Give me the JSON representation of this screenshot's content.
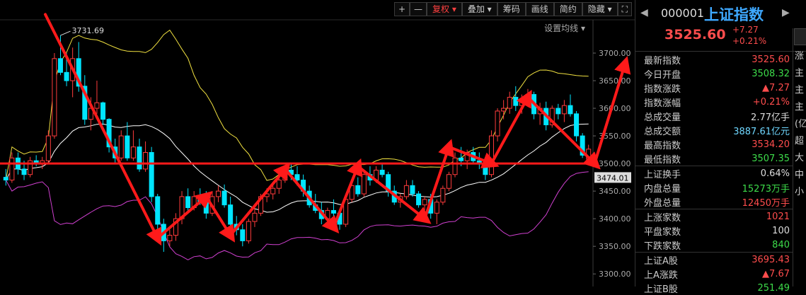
{
  "toolbar": {
    "plus": "+",
    "minus": "—",
    "fuquan": "复权 ▾",
    "diejia": "叠加 ▾",
    "chouma": "筹码",
    "huaxian": "画线",
    "jianyue": "简约",
    "yincang": "隐藏 ▾",
    "fullscreen": "⛶",
    "ma_setting": "设置均线 ▾"
  },
  "quote": {
    "code": "000001",
    "name": "上证指数",
    "price": "3525.60",
    "change": "+7.27",
    "change_pct": "+0.21%",
    "rows": [
      {
        "label": "最新指数",
        "value": "3525.60",
        "color": "#ff4d4d"
      },
      {
        "label": "今日开盘",
        "value": "3508.32",
        "color": "#3ddc4a"
      },
      {
        "label": "指数涨跌",
        "value": "▲7.27",
        "color": "#ff4d4d"
      },
      {
        "label": "指数涨幅",
        "value": "+0.21%",
        "color": "#ff4d4d"
      },
      {
        "label": "总成交量",
        "value": "2.77亿手",
        "color": "#dddddd"
      },
      {
        "label": "总成交额",
        "value": "3887.61亿元",
        "color": "#6fd7ff"
      },
      {
        "label": "最高指数",
        "value": "3534.20",
        "color": "#ff4d4d"
      },
      {
        "label": "最低指数",
        "value": "3507.35",
        "color": "#3ddc4a"
      },
      {
        "label": "上证换手",
        "value": "0.64%",
        "color": "#dddddd",
        "sep": true
      },
      {
        "label": "内盘总量",
        "value": "15273万手",
        "color": "#3ddc4a"
      },
      {
        "label": "外盘总量",
        "value": "12450万手",
        "color": "#ff4d4d"
      },
      {
        "label": "上涨家数",
        "value": "1021",
        "color": "#ff4d4d",
        "sep": true
      },
      {
        "label": "平盘家数",
        "value": "100",
        "color": "#dddddd"
      },
      {
        "label": "下跌家数",
        "value": "840",
        "color": "#3ddc4a"
      },
      {
        "label": "上证A股",
        "value": "3695.43",
        "color": "#ff4d4d",
        "sep": true
      },
      {
        "label": "上A涨跌",
        "value": "▲7.67",
        "color": "#ff4d4d"
      },
      {
        "label": "上证B股",
        "value": "251.49",
        "color": "#3ddc4a"
      }
    ],
    "strip": [
      "涨",
      "主",
      "主",
      "主",
      "(亿",
      "超",
      "大",
      "中",
      "小"
    ]
  },
  "chart_data": {
    "type": "candlestick",
    "y_ticks": [
      "3700.00",
      "3650.00",
      "3600.00",
      "3550.00",
      "3500.00",
      "3450.00",
      "3400.00",
      "3350.00",
      "3300.00"
    ],
    "ylim": [
      3290,
      3750
    ],
    "high_annotation": "3731.69",
    "current_level_label": "3474.01",
    "colors": {
      "up": "#ff3c3c",
      "down": "#00e5ff",
      "ma": "#ffffff",
      "upper": "#f0e040",
      "lower": "#d040d0",
      "arrow": "#ff1a1a"
    },
    "candles": [
      [
        3475,
        3490,
        3460,
        3470
      ],
      [
        3470,
        3520,
        3465,
        3510
      ],
      [
        3510,
        3520,
        3480,
        3490
      ],
      [
        3490,
        3505,
        3470,
        3480
      ],
      [
        3480,
        3512,
        3475,
        3505
      ],
      [
        3505,
        3515,
        3495,
        3500
      ],
      [
        3500,
        3512,
        3490,
        3505
      ],
      [
        3505,
        3560,
        3500,
        3550
      ],
      [
        3550,
        3700,
        3545,
        3690
      ],
      [
        3690,
        3732,
        3660,
        3665
      ],
      [
        3665,
        3700,
        3640,
        3650
      ],
      [
        3650,
        3710,
        3620,
        3690
      ],
      [
        3690,
        3720,
        3630,
        3640
      ],
      [
        3640,
        3660,
        3570,
        3580
      ],
      [
        3580,
        3620,
        3560,
        3600
      ],
      [
        3600,
        3650,
        3590,
        3610
      ],
      [
        3610,
        3612,
        3570,
        3580
      ],
      [
        3580,
        3582,
        3520,
        3530
      ],
      [
        3530,
        3545,
        3500,
        3510
      ],
      [
        3510,
        3560,
        3505,
        3550
      ],
      [
        3550,
        3575,
        3505,
        3510
      ],
      [
        3510,
        3560,
        3505,
        3530
      ],
      [
        3530,
        3545,
        3485,
        3490
      ],
      [
        3490,
        3540,
        3485,
        3520
      ],
      [
        3520,
        3530,
        3430,
        3440
      ],
      [
        3440,
        3445,
        3370,
        3390
      ],
      [
        3390,
        3400,
        3340,
        3360
      ],
      [
        3360,
        3380,
        3350,
        3370
      ],
      [
        3370,
        3410,
        3360,
        3400
      ],
      [
        3400,
        3450,
        3390,
        3440
      ],
      [
        3440,
        3455,
        3410,
        3420
      ],
      [
        3420,
        3450,
        3415,
        3440
      ],
      [
        3440,
        3455,
        3425,
        3430
      ],
      [
        3430,
        3450,
        3400,
        3410
      ],
      [
        3410,
        3450,
        3405,
        3440
      ],
      [
        3440,
        3460,
        3430,
        3450
      ],
      [
        3450,
        3462,
        3420,
        3425
      ],
      [
        3425,
        3440,
        3380,
        3390
      ],
      [
        3390,
        3405,
        3370,
        3380
      ],
      [
        3380,
        3390,
        3350,
        3360
      ],
      [
        3360,
        3400,
        3355,
        3395
      ],
      [
        3395,
        3420,
        3385,
        3410
      ],
      [
        3410,
        3445,
        3405,
        3440
      ],
      [
        3440,
        3455,
        3430,
        3445
      ],
      [
        3445,
        3462,
        3435,
        3455
      ],
      [
        3455,
        3475,
        3445,
        3470
      ],
      [
        3470,
        3492,
        3465,
        3488
      ],
      [
        3488,
        3500,
        3470,
        3480
      ],
      [
        3480,
        3495,
        3460,
        3470
      ],
      [
        3470,
        3480,
        3440,
        3450
      ],
      [
        3450,
        3460,
        3420,
        3425
      ],
      [
        3425,
        3445,
        3410,
        3415
      ],
      [
        3415,
        3430,
        3390,
        3400
      ],
      [
        3400,
        3420,
        3385,
        3415
      ],
      [
        3415,
        3435,
        3400,
        3410
      ],
      [
        3410,
        3415,
        3380,
        3390
      ],
      [
        3390,
        3440,
        3385,
        3435
      ],
      [
        3435,
        3465,
        3430,
        3460
      ],
      [
        3460,
        3475,
        3440,
        3445
      ],
      [
        3445,
        3485,
        3440,
        3480
      ],
      [
        3480,
        3495,
        3460,
        3470
      ],
      [
        3470,
        3495,
        3465,
        3488
      ],
      [
        3488,
        3500,
        3475,
        3480
      ],
      [
        3480,
        3485,
        3440,
        3450
      ],
      [
        3450,
        3460,
        3425,
        3430
      ],
      [
        3430,
        3445,
        3420,
        3440
      ],
      [
        3440,
        3470,
        3435,
        3460
      ],
      [
        3460,
        3470,
        3440,
        3445
      ],
      [
        3445,
        3450,
        3420,
        3425
      ],
      [
        3425,
        3440,
        3415,
        3435
      ],
      [
        3435,
        3445,
        3400,
        3410
      ],
      [
        3410,
        3435,
        3390,
        3430
      ],
      [
        3430,
        3460,
        3425,
        3455
      ],
      [
        3455,
        3485,
        3450,
        3480
      ],
      [
        3480,
        3520,
        3475,
        3510
      ],
      [
        3510,
        3530,
        3495,
        3505
      ],
      [
        3505,
        3525,
        3490,
        3520
      ],
      [
        3520,
        3530,
        3500,
        3505
      ],
      [
        3505,
        3520,
        3490,
        3500
      ],
      [
        3500,
        3510,
        3470,
        3480
      ],
      [
        3480,
        3560,
        3475,
        3550
      ],
      [
        3550,
        3600,
        3540,
        3595
      ],
      [
        3595,
        3615,
        3580,
        3600
      ],
      [
        3600,
        3630,
        3590,
        3620
      ],
      [
        3620,
        3640,
        3595,
        3605
      ],
      [
        3605,
        3625,
        3590,
        3615
      ],
      [
        3615,
        3635,
        3605,
        3625
      ],
      [
        3625,
        3630,
        3580,
        3590
      ],
      [
        3590,
        3610,
        3570,
        3600
      ],
      [
        3600,
        3612,
        3560,
        3570
      ],
      [
        3570,
        3605,
        3565,
        3600
      ],
      [
        3600,
        3608,
        3580,
        3590
      ],
      [
        3590,
        3615,
        3575,
        3605
      ],
      [
        3605,
        3625,
        3585,
        3590
      ],
      [
        3590,
        3595,
        3540,
        3550
      ],
      [
        3550,
        3555,
        3510,
        3515
      ],
      [
        3508,
        3534,
        3507,
        3526
      ]
    ]
  }
}
